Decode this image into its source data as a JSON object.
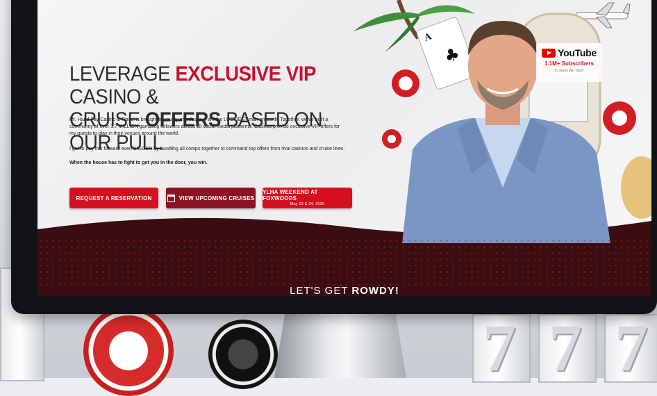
{
  "hero": {
    "headline_line1_plain": "LEVERAGE ",
    "headline_line1_red": "EXCLUSIVE VIP",
    "headline_line1_end": " CASINO &",
    "headline_line2_start": "CRUISE ",
    "headline_line2_bold": "OFFERS",
    "headline_line2_end": " BASED ON OUR PULL",
    "paragraph1": "Mr. Hand Pay Casino & Travel is brought to you by me, Jason. I am the LUCKIEST man on earth. Together, we've built a community of over 1.7 MILLION gambling followers across all social media platforms. Casinos provide exclusive VIP offers for my guests to play in their venues around the world.",
    "paragraph2": "I get to pay this forward even BIGGER by bundling all comps together to command top offers from rival casinos and cruise lines.",
    "paragraph3": "When the house has to fight to get you in the door, you win."
  },
  "buttons": {
    "reservation": "REQUEST A RESERVATION",
    "cruises": "VIEW UPCOMING CRUISES",
    "ylha_title": "YLHA WEEKEND AT FOXWOODS",
    "ylha_sub": "May 23 & 24, 2026"
  },
  "youtube": {
    "logo_word": "YouTube",
    "subscribers": "1.1M+ Subscribers",
    "tagline": "In Jason We Trust!"
  },
  "banner": {
    "heading_plain": "LET'S GET ",
    "heading_bold": "ROWDY!"
  },
  "background": {
    "seven": "7"
  },
  "colors": {
    "brand_red": "#c8102e",
    "dark_red": "#8a1422",
    "banner": "#2a0a0c"
  },
  "icons": [
    "calendar-icon",
    "youtube-play-icon",
    "playing-card-icon",
    "poker-chip-icon",
    "airplane-icon",
    "palm-tree-icon"
  ]
}
